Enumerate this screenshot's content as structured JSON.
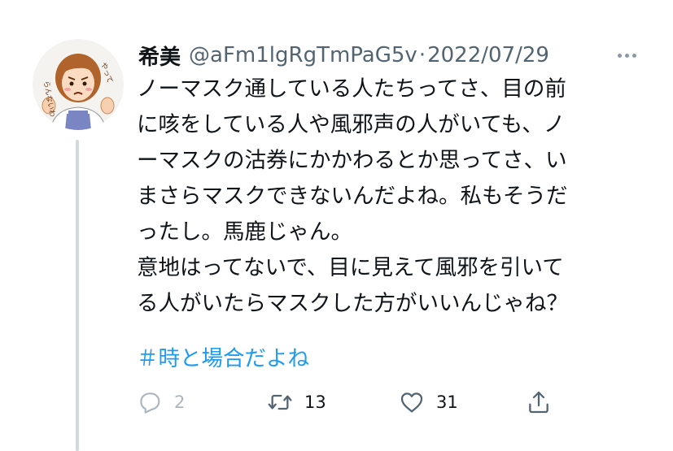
{
  "tweet": {
    "display_name": "希美",
    "handle": "@aFm1lgRgTmPaG5v",
    "separator": "·",
    "date": "2022/07/29",
    "text": "ノーマスク通している人たちってさ、目の前\nに咳をしている人や風邪声の人がいても、ノ\nーマスクの沽券にかかわるとか思ってさ、い\nまさらマスクできないんだよね。私もそうだ\nったし。馬鹿じゃん。\n意地はってないで、目に見えて風邪を引いて\nる人がいたらマスクした方がいいんじゃね？",
    "hashtag": "＃時と場合だよね",
    "avatar_caption": "やってらんないわ"
  },
  "actions": {
    "reply_count": "2",
    "retweet_count": "13",
    "like_count": "31"
  },
  "icons": {
    "more": "more-horizontal-icon",
    "reply": "reply-icon",
    "retweet": "retweet-icon",
    "like": "heart-icon",
    "share": "share-icon"
  },
  "colors": {
    "text": "#0f1419",
    "secondary": "#536471",
    "hashtag": "#1d9bf0",
    "icon": "#536471",
    "reply_muted": "#aab5bf",
    "thread_line": "#cfd9de"
  }
}
